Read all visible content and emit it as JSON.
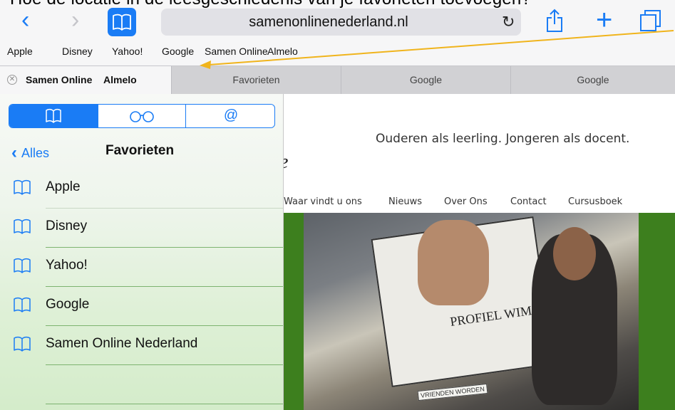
{
  "caption": "Hoe de locatie in de leesgeschiedenis van je favorieten toevoegen?",
  "toolbar": {
    "url": "samenonlinenederland.nl"
  },
  "favorites_bar": [
    "Apple",
    "Disney",
    "Yahoo!",
    "Google",
    "Samen Online",
    "Almelo"
  ],
  "tabs": [
    {
      "label_a": "Samen Online",
      "label_b": "Almelo"
    },
    {
      "label": "Favorieten"
    },
    {
      "label": "Google"
    },
    {
      "label": "Google"
    }
  ],
  "sidebar": {
    "segments": [
      "bookmarks",
      "reading-list",
      "shared-links"
    ],
    "segment_glyphs": [
      "🕮",
      "○○",
      "@"
    ],
    "back_label": "Alles",
    "title": "Favorieten",
    "items": [
      "Apple",
      "Disney",
      "Yahoo!",
      "Google",
      "Samen Online Nederland"
    ]
  },
  "webpage": {
    "tagline": "Ouderen als leerling. Jongeren als docent.",
    "logo_fragment": "e",
    "nav": [
      "Waar vindt u ons",
      "Nieuws",
      "Over Ons",
      "Contact",
      "Cursusboek"
    ],
    "hero_sign": "PROFIEL WIM",
    "hero_note": "VRIENDEN WORDEN"
  },
  "colors": {
    "accent": "#1a7cf5",
    "annotation_arrow": "#f0b41c",
    "site_green": "#3d7f1e"
  }
}
